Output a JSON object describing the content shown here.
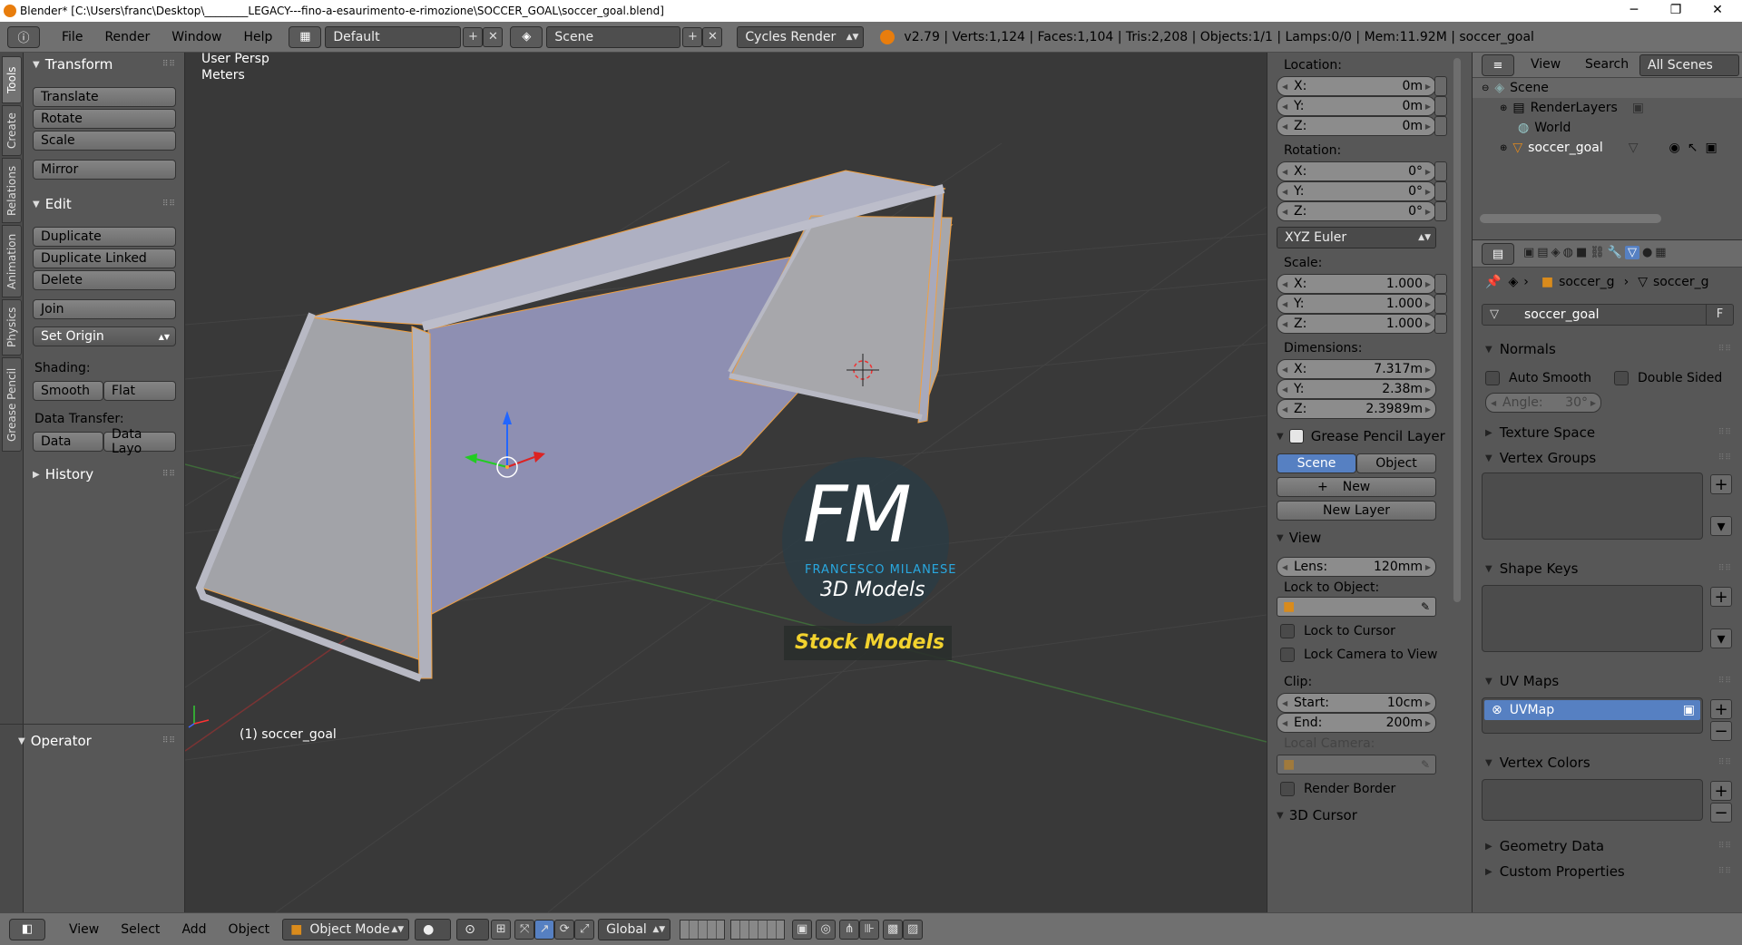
{
  "window": {
    "title": "Blender* [C:\\Users\\franc\\Desktop\\________LEGACY---fino-a-esaurimento-e-rimozione\\SOCCER_GOAL\\soccer_goal.blend]",
    "minimize": "─",
    "restore": "❐",
    "close": "✕"
  },
  "topbar": {
    "menus": [
      "File",
      "Render",
      "Window",
      "Help"
    ],
    "layout": "Default",
    "scene": "Scene",
    "engine": "Cycles Render",
    "stats": "v2.79 | Verts:1,124 | Faces:1,104 | Tris:2,208 | Objects:1/1 | Lamps:0/0 | Mem:11.92M | soccer_goal"
  },
  "vtabs": [
    "Tools",
    "Create",
    "Relations",
    "Animation",
    "Physics",
    "Grease Pencil"
  ],
  "toolshelf": {
    "transform_header": "Transform",
    "translate": "Translate",
    "rotate": "Rotate",
    "scale": "Scale",
    "mirror": "Mirror",
    "edit_header": "Edit",
    "duplicate": "Duplicate",
    "duplicate_linked": "Duplicate Linked",
    "delete": "Delete",
    "join": "Join",
    "set_origin": "Set Origin",
    "shading_label": "Shading:",
    "smooth": "Smooth",
    "flat": "Flat",
    "data_transfer_label": "Data Transfer:",
    "data": "Data",
    "data_layo": "Data Layo",
    "history_header": "History",
    "operator_header": "Operator"
  },
  "viewport": {
    "view_name": "User Persp",
    "units": "Meters",
    "object_label": "(1) soccer_goal",
    "watermark_fm": "FM",
    "watermark_name": "FRANCESCO MILANESE",
    "watermark_sub": "3D Models",
    "watermark_stock": "Stock Models"
  },
  "npanel": {
    "location_label": "Location:",
    "loc": [
      {
        "k": "X:",
        "v": "0m"
      },
      {
        "k": "Y:",
        "v": "0m"
      },
      {
        "k": "Z:",
        "v": "0m"
      }
    ],
    "rotation_label": "Rotation:",
    "rot": [
      {
        "k": "X:",
        "v": "0°"
      },
      {
        "k": "Y:",
        "v": "0°"
      },
      {
        "k": "Z:",
        "v": "0°"
      }
    ],
    "rotation_mode": "XYZ Euler",
    "scale_label": "Scale:",
    "scl": [
      {
        "k": "X:",
        "v": "1.000"
      },
      {
        "k": "Y:",
        "v": "1.000"
      },
      {
        "k": "Z:",
        "v": "1.000"
      }
    ],
    "dimensions_label": "Dimensions:",
    "dim": [
      {
        "k": "X:",
        "v": "7.317m"
      },
      {
        "k": "Y:",
        "v": "2.38m"
      },
      {
        "k": "Z:",
        "v": "2.3989m"
      }
    ],
    "gp_header": "Grease Pencil Layer",
    "gp_scene": "Scene",
    "gp_object": "Object",
    "gp_new": "New",
    "gp_new_layer": "New Layer",
    "view_header": "View",
    "lens_label": "Lens:",
    "lens_value": "120mm",
    "lock_to_object": "Lock to Object:",
    "lock_to_cursor": "Lock to Cursor",
    "lock_camera": "Lock Camera to View",
    "clip_label": "Clip:",
    "clip_start_label": "Start:",
    "clip_start": "10cm",
    "clip_end_label": "End:",
    "clip_end": "200m",
    "local_camera": "Local Camera:",
    "render_border": "Render Border",
    "cursor_header": "3D Cursor"
  },
  "outliner": {
    "view": "View",
    "search": "Search",
    "all_scenes": "All Scenes",
    "scene": "Scene",
    "renderlayers": "RenderLayers",
    "world": "World",
    "soccer_goal": "soccer_goal"
  },
  "props": {
    "crumb1": "soccer_g",
    "crumb2": "soccer_g",
    "mesh_name": "soccer_goal",
    "fake_user": "F",
    "normals": "Normals",
    "auto_smooth": "Auto Smooth",
    "double_sided": "Double Sided",
    "angle_label": "Angle:",
    "angle_value": "30°",
    "texture_space": "Texture Space",
    "vertex_groups": "Vertex Groups",
    "shape_keys": "Shape Keys",
    "uv_maps": "UV Maps",
    "uvmap": "UVMap",
    "vertex_colors": "Vertex Colors",
    "geometry_data": "Geometry Data",
    "custom_properties": "Custom Properties"
  },
  "bottombar": {
    "view": "View",
    "select": "Select",
    "add": "Add",
    "object": "Object",
    "mode": "Object Mode",
    "orientation": "Global"
  },
  "colors": {
    "accent_blue": "#5680c2",
    "outline_orange": "#f0a040",
    "watermark_blue": "#29a8e0",
    "watermark_yellow": "#f2d22e"
  }
}
